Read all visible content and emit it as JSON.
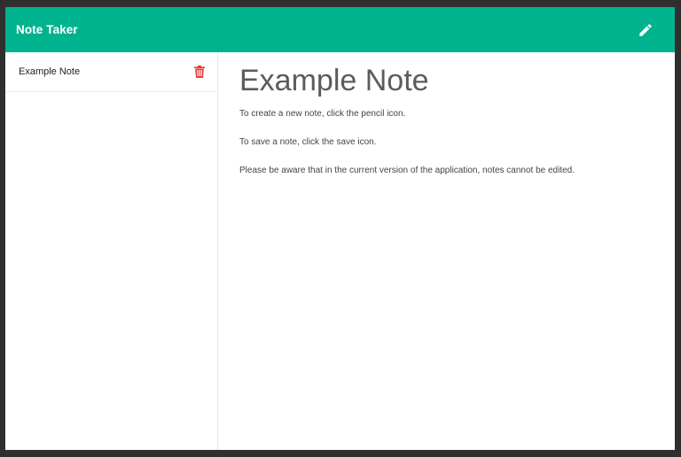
{
  "navbar": {
    "brand": "Note Taker",
    "new_note_icon": "pencil-icon",
    "background": "#00b38f"
  },
  "sidebar": {
    "notes": [
      {
        "title": "Example Note",
        "delete_icon": "trash-icon",
        "delete_color": "#e53935"
      }
    ]
  },
  "main": {
    "title": "Example Note",
    "paragraphs": [
      "To create a new note, click the pencil icon.",
      "To save a note, click the save icon.",
      "Please be aware that in the current version of the application, notes cannot be edited."
    ]
  }
}
